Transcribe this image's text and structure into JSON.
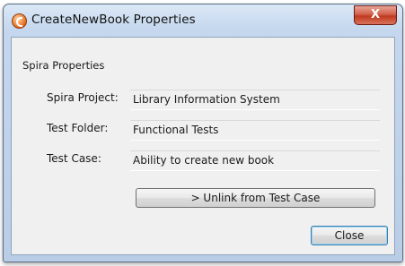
{
  "window": {
    "title": "CreateNewBook Properties",
    "close_glyph": "X"
  },
  "group": {
    "title": "Spira Properties"
  },
  "fields": [
    {
      "label": "Spira Project:",
      "value": "Library Information System"
    },
    {
      "label": "Test Folder:",
      "value": "Functional Tests"
    },
    {
      "label": "Test Case:",
      "value": "Ability to create new book"
    }
  ],
  "buttons": {
    "unlink_label": "> Unlink from Test Case",
    "close_label": "Close"
  },
  "colors": {
    "title_bar": "#c4d7ee",
    "close_button": "#c0391f",
    "client_bg": "#f0f0f0",
    "default_button_border": "#3c7fb1"
  }
}
